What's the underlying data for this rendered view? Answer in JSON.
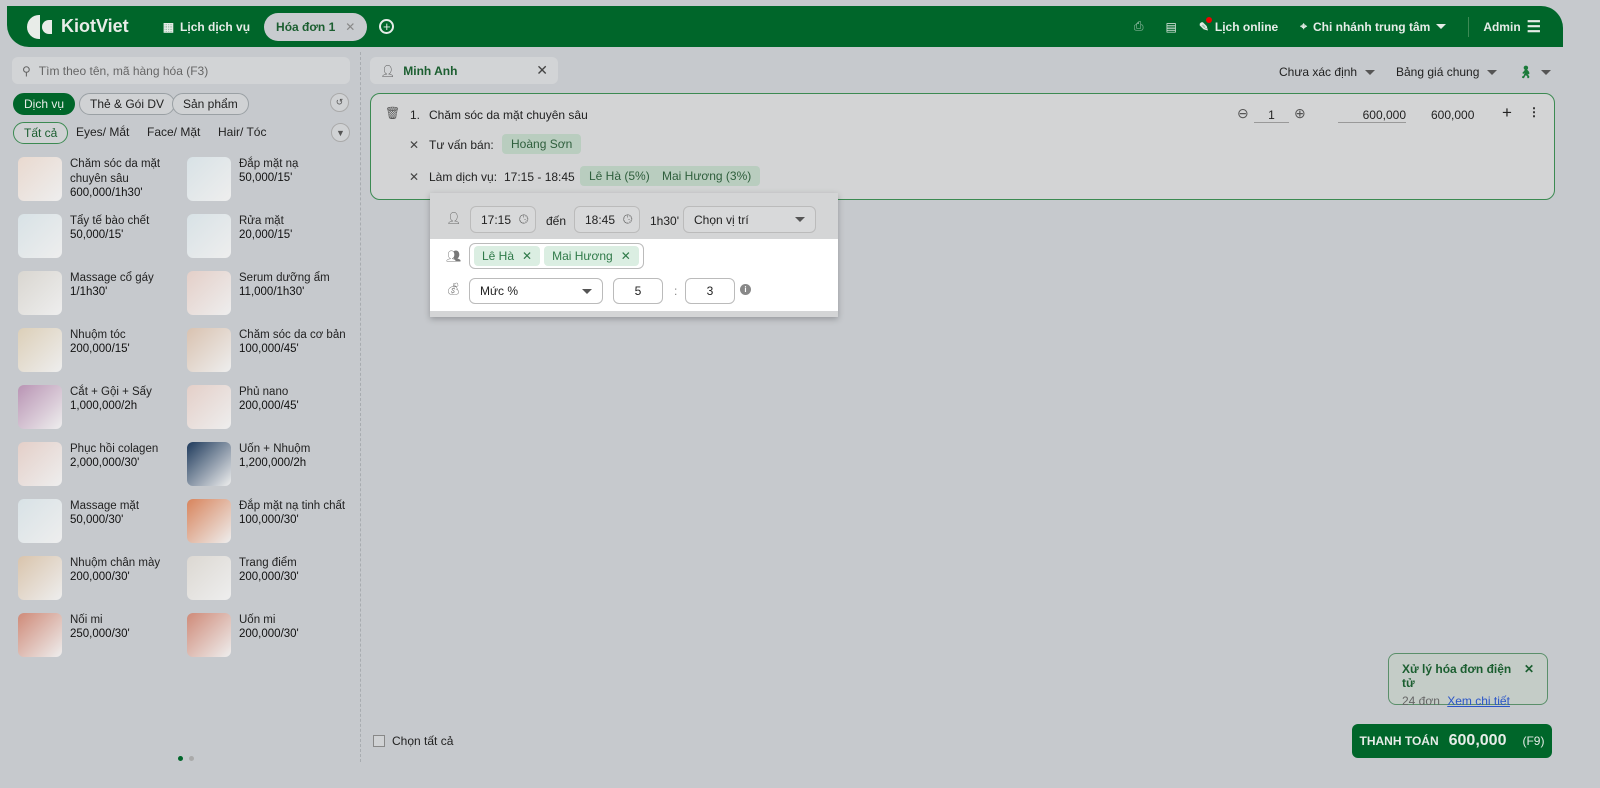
{
  "header": {
    "brand": "KiotViet",
    "schedule": "Lịch dịch vụ",
    "tab": "Hóa đơn 1",
    "online": "Lịch online",
    "branch": "Chi nhánh trung tâm",
    "user": "Admin"
  },
  "left": {
    "search_placeholder": "Tìm theo tên, mã hàng hóa (F3)",
    "types": [
      "Dịch vụ",
      "Thẻ & Gói DV",
      "Sản phẩm"
    ],
    "categories": [
      "Tất cả",
      "Eyes/ Mắt",
      "Face/ Mặt",
      "Hair/ Tóc"
    ],
    "items": [
      {
        "name": "Chăm sóc da mặt chuyên sâu",
        "price": "600,000/1h30'",
        "color": "#e9d9cf"
      },
      {
        "name": "Đắp mặt nạ",
        "price": "50,000/15'",
        "color": "#d8e2e6"
      },
      {
        "name": "Tẩy tế bào chết",
        "price": "50,000/15'",
        "color": "#d8e2e6"
      },
      {
        "name": "Rửa mặt",
        "price": "20,000/15'",
        "color": "#d8e2e6"
      },
      {
        "name": "Massage cổ gáy",
        "price": "1/1h30'",
        "color": "#d9d6d0"
      },
      {
        "name": "Serum dưỡng ẩm",
        "price": "11,000/1h30'",
        "color": "#e4cfc8"
      },
      {
        "name": "Nhuộm tóc",
        "price": "200,000/15'",
        "color": "#dccfb8"
      },
      {
        "name": "Chăm sóc da cơ bản",
        "price": "100,000/45'",
        "color": "#d9c2b0"
      },
      {
        "name": "Cắt + Gội + Sấy",
        "price": "1,000,000/2h",
        "color": "#b994b4"
      },
      {
        "name": "Phủ nano",
        "price": "200,000/45'",
        "color": "#e4cfc8"
      },
      {
        "name": "Phục hồi colagen",
        "price": "2,000,000/30'",
        "color": "#e4cfc8"
      },
      {
        "name": "Uốn + Nhuộm",
        "price": "1,200,000/2h",
        "color": "#1e3a5c"
      },
      {
        "name": "Massage mặt",
        "price": "50,000/30'",
        "color": "#d8e2e6"
      },
      {
        "name": "Đắp mặt nạ tinh chất",
        "price": "100,000/30'",
        "color": "#d8845c"
      },
      {
        "name": "Nhuộm chân mày",
        "price": "200,000/30'",
        "color": "#d9c4ac"
      },
      {
        "name": "Trang điểm",
        "price": "200,000/30'",
        "color": "#dcd8d2"
      },
      {
        "name": "Nối mi",
        "price": "250,000/30'",
        "color": "#cf8a78"
      },
      {
        "name": "Uốn mi",
        "price": "200,000/30'",
        "color": "#cf8a78"
      }
    ]
  },
  "order": {
    "customer": "Minh Anh",
    "status": "Chưa xác định",
    "pricebook": "Bảng giá chung",
    "line": {
      "index": "1.",
      "name": "Chăm sóc da mặt chuyên sâu",
      "qty": "1",
      "price": "600,000",
      "total": "600,000",
      "consult_label": "Tư vấn bán:",
      "consultant": "Hoàng Sơn",
      "service_label": "Làm dịch vụ:",
      "time": "17:15 - 18:45",
      "staff": [
        "Lê Hà (5%)",
        "Mai Hương (3%)"
      ]
    },
    "popup": {
      "from": "17:15",
      "to_label": "đến",
      "to": "18:45",
      "duration": "1h30'",
      "position_placeholder": "Chọn vị trí",
      "staff": [
        "Lê Hà",
        "Mai Hương"
      ],
      "rate_type": "Mức %",
      "rate1": "5",
      "sep": ":",
      "rate2": "3"
    },
    "select_all": "Chọn tất cả"
  },
  "notification": {
    "title": "Xử lý hóa đơn điện tử",
    "count": "24 đơn",
    "link": "Xem chi tiết"
  },
  "payment": {
    "label": "THANH TOÁN",
    "amount": "600,000",
    "shortcut": "(F9)"
  }
}
